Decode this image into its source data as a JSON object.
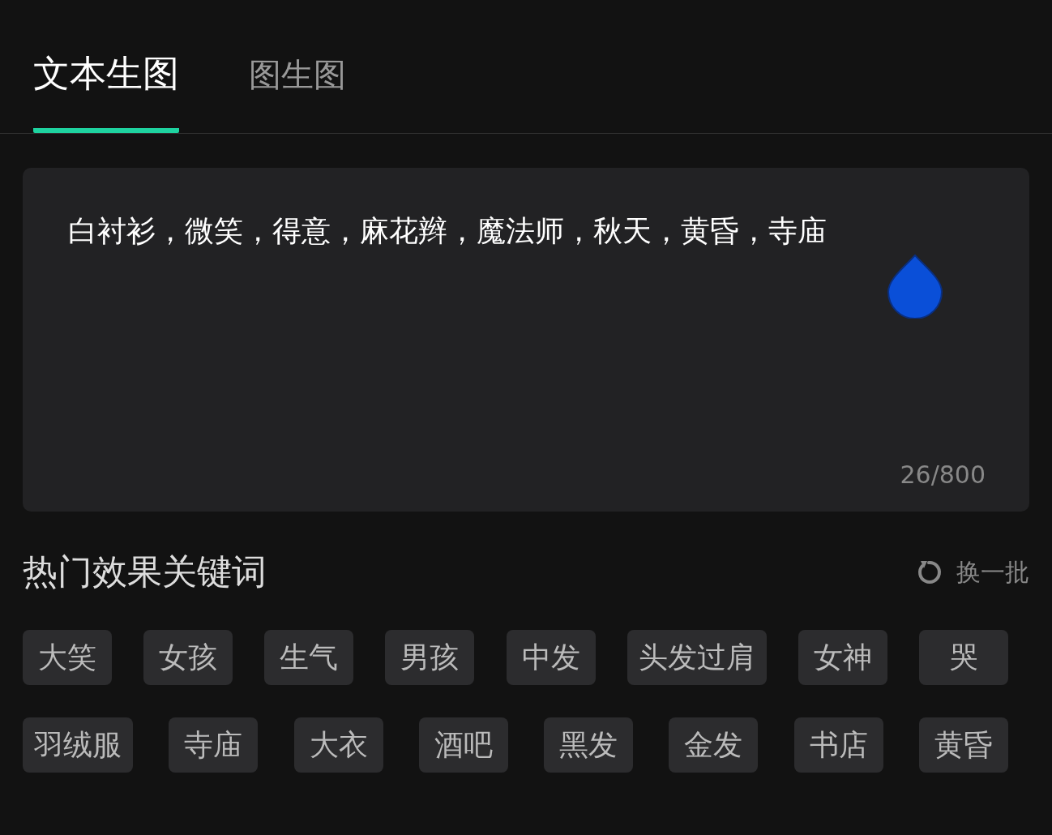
{
  "tabs": [
    {
      "label": "文本生图",
      "selected": true
    },
    {
      "label": "图生图",
      "selected": false
    }
  ],
  "prompt": {
    "value": "白衬衫，微笑，得意，麻花辫，魔法师，秋天，黄昏，寺庙",
    "counter": "26/800"
  },
  "keywords": {
    "title": "热门效果关键词",
    "refresh": "换一批",
    "rows": [
      [
        "大笑",
        "女孩",
        "生气",
        "男孩",
        "中发",
        "头发过肩",
        "女神",
        "哭"
      ],
      [
        "羽绒服",
        "寺庙",
        "大衣",
        "酒吧",
        "黑发",
        "金发",
        "书店",
        "黄昏"
      ]
    ]
  }
}
